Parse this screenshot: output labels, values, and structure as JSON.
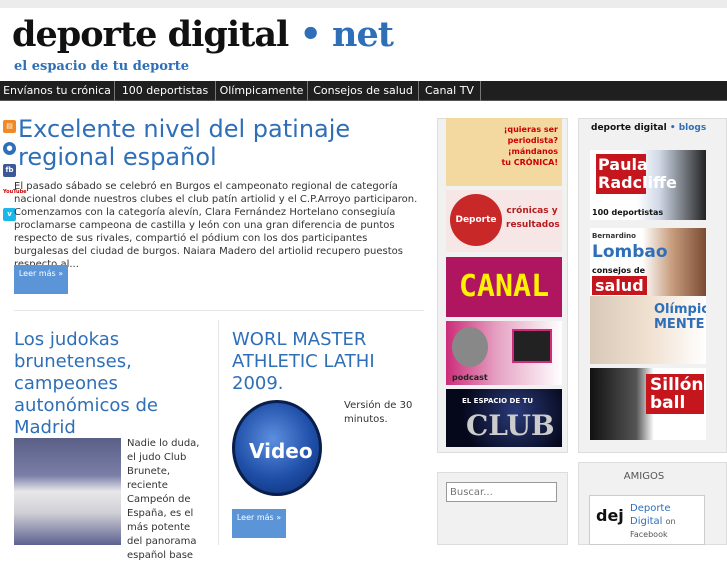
{
  "site": {
    "logo_main": "deporte digital",
    "logo_dot": "•",
    "logo_net": "net",
    "slogan": "el espacio de tu deporte"
  },
  "nav": [
    "Envíanos tu crónica",
    "100 deportistas",
    "Olímpicamente",
    "Consejos de salud",
    "Canal TV"
  ],
  "social": [
    "rss-icon",
    "feed-icon",
    "fb",
    "YouTube",
    "vimeo-icon"
  ],
  "article1": {
    "title": "Excelente nivel del patinaje regional español",
    "text": "El pasado sábado se celebró en Burgos el campeonato regional de categoría nacional donde nuestros clubes el club patín artiolid y el C.P.Arroyo participaron. Comenzamos con la categoría alevín, Clara Fernández Hortelano consegiuía proclamarse campeona de castilla y león con una gran diferencia de puntos respecto de sus rivales, compartió el pódium con los dos participantes burgalesas del ciudad de burgos. Naiara Madero del artiolid recupero puestos respecto al...",
    "more": "Leer más »"
  },
  "article2": {
    "title": "Los judokas brunetenses, campeones autonómicos de Madrid",
    "text": "Nadie lo duda, el judo Club Brunete, reciente Campeón de España, es el más potente del panorama español base"
  },
  "article3": {
    "title": "WORL MASTER ATHLETIC LATHI 2009.",
    "text": "Versión de 30 minutos.",
    "video_label": "Video",
    "more": "Leer más »"
  },
  "banners": {
    "cronica": "¡quieras ser periodista? ¡mándanos tu CRÓNICA!",
    "resultados_logo": "Deporte 2D",
    "resultados": "crónicas y resultados",
    "canaltv": "CANAL tv",
    "podcast": "podcast",
    "club_top": "EL ESPACIO DE TU",
    "club": "CLUB"
  },
  "search": {
    "placeholder": "Buscar..."
  },
  "blogs": {
    "title_main": "deporte digital",
    "title_blogs": "• blogs",
    "paula": "Paula Radcliffe",
    "deportistas": "100 deportistas",
    "lombao_first": "Bernardino",
    "lombao": "Lombao",
    "consejos": "consejos de",
    "salud": "salud",
    "olimpica": "Olímpica MENTE",
    "sillon": "Sillón ball"
  },
  "amigos": {
    "title": "AMIGOS",
    "fb_logo": "dej",
    "fb_name": "Deporte Digital",
    "fb_on": "on",
    "fb_platform": "Facebook"
  }
}
